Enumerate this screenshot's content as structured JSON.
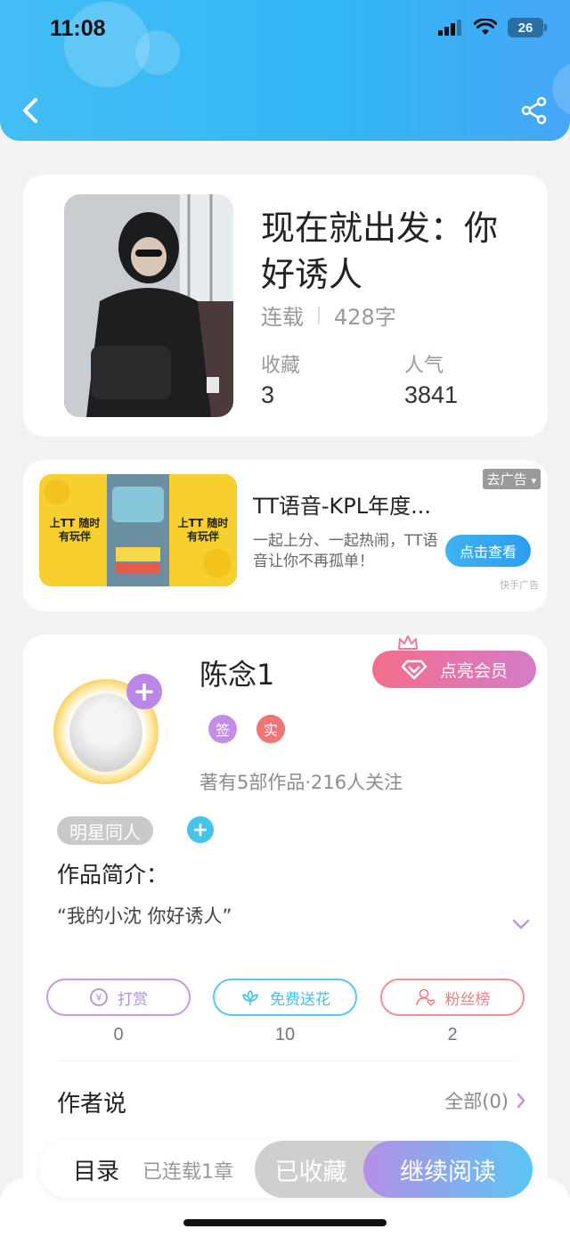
{
  "status_bar": {
    "time": "11:08",
    "battery": "26"
  },
  "book": {
    "title": "现在就出发：你好诱人",
    "status": "连载",
    "word_count": "428字",
    "favorites_label": "收藏",
    "favorites_value": "3",
    "popularity_label": "人气",
    "popularity_value": "3841"
  },
  "ad": {
    "image_text_left": "上TT 随时有玩伴",
    "image_text_right": "上TT 随时有玩伴",
    "title": "TT语音-KPL年度...",
    "description": "一起上分、一起热闹，TT语音让你不再孤单！",
    "button": "点击查看",
    "close_label": "去广告",
    "source": "快手广告"
  },
  "author": {
    "name": "陈念1",
    "vip_button": "点亮会员",
    "badges": [
      "签",
      "实"
    ],
    "meta": "著有5部作品·216人关注",
    "tag": "明星同人",
    "intro_label": "作品简介：",
    "intro_text": "“我的小沈 你好诱人”"
  },
  "actions": [
    {
      "label": "打赏",
      "count": "0",
      "color": "#b78be4"
    },
    {
      "label": "免费送花",
      "count": "10",
      "color": "#47c1e9"
    },
    {
      "label": "粉丝榜",
      "count": "2",
      "color": "#ec7f86"
    }
  ],
  "author_says": {
    "label": "作者说",
    "all_link": "全部(0)"
  },
  "bottom": {
    "toc": "目录",
    "toc_sub": "已连载1章",
    "collected": "已收藏",
    "continue": "继续阅读"
  }
}
